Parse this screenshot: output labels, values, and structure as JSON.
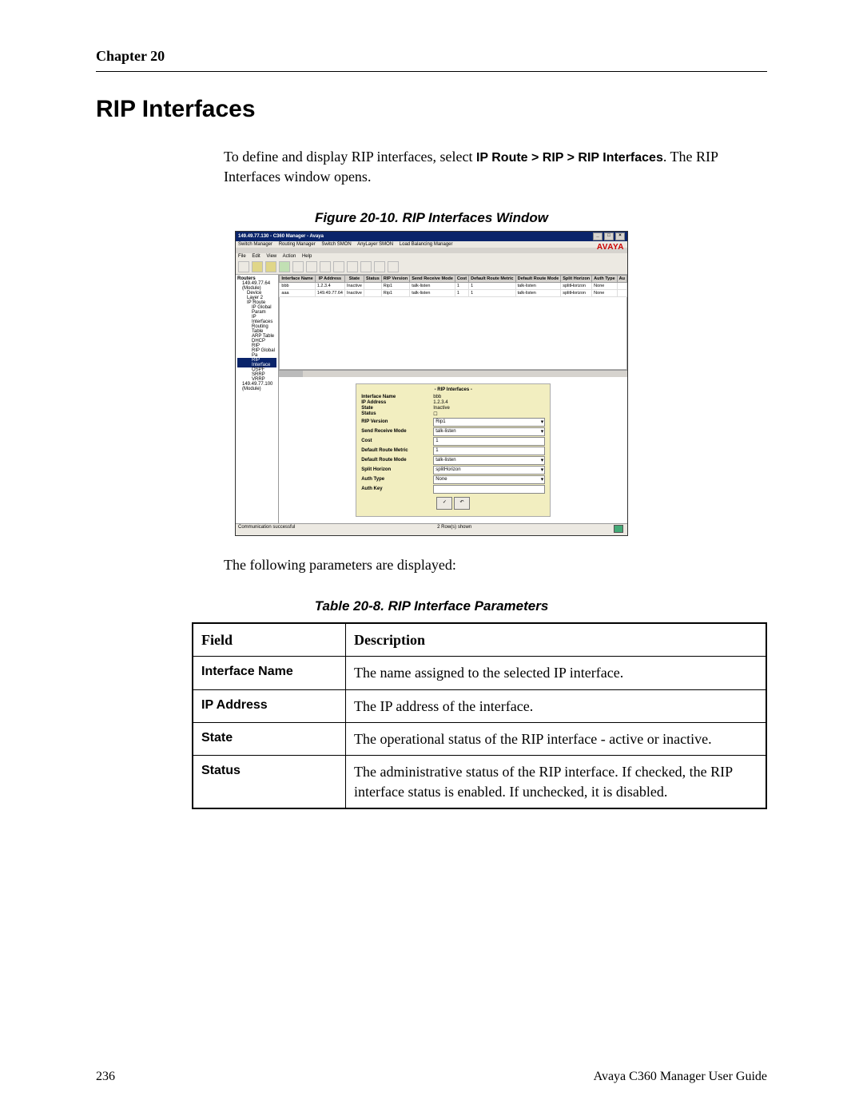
{
  "header": {
    "chapter": "Chapter 20"
  },
  "title": "RIP Interfaces",
  "intro": {
    "pre": "To define and display RIP interfaces, select ",
    "path": "IP Route > RIP > RIP Interfaces",
    "post": ". The RIP Interfaces window opens."
  },
  "figure_caption": "Figure 20-10. RIP Interfaces Window",
  "screenshot": {
    "titlebar": "149.49.77.130 - C360 Manager - Avaya",
    "logo": "AVAYA",
    "tabs": [
      "Switch Manager",
      "Routing Manager",
      "Switch SMON",
      "AnyLayer SMON",
      "Load Balancing Manager"
    ],
    "menus": [
      "File",
      "Edit",
      "View",
      "Action",
      "Help"
    ],
    "tree": [
      {
        "t": "Routers",
        "lvl": 0
      },
      {
        "t": "149.49.77.64 (Module)",
        "lvl": 1
      },
      {
        "t": "Device",
        "lvl": 2
      },
      {
        "t": "Layer 2",
        "lvl": 2
      },
      {
        "t": "IP Route",
        "lvl": 2
      },
      {
        "t": "IP Global Param",
        "lvl": 3
      },
      {
        "t": "IP Interfaces",
        "lvl": 3
      },
      {
        "t": "Routing Table",
        "lvl": 3
      },
      {
        "t": "ARP Table",
        "lvl": 3
      },
      {
        "t": "DHCP",
        "lvl": 3
      },
      {
        "t": "RIP",
        "lvl": 3
      },
      {
        "t": "RIP Global Pa",
        "lvl": 3
      },
      {
        "t": "RIP Interface",
        "lvl": 3,
        "sel": true
      },
      {
        "t": "OSPF",
        "lvl": 3
      },
      {
        "t": "SRRP",
        "lvl": 3
      },
      {
        "t": "VRRP",
        "lvl": 3
      },
      {
        "t": "149.49.77.100 (Module)",
        "lvl": 1
      }
    ],
    "grid": {
      "headers": [
        "Interface Name",
        "IP Address",
        "State",
        "Status",
        "RIP Version",
        "Send Receive Mode",
        "Cost",
        "Default Route Metric",
        "Default Route Mode",
        "Split Horizon",
        "Auth Type",
        "Au"
      ],
      "rows": [
        [
          "bbb",
          "1.2.3.4",
          "Inactive",
          "",
          "Rip1",
          "talk-listen",
          "1",
          "1",
          "talk-listen",
          "splitHorizon",
          "None",
          ""
        ],
        [
          "aaa",
          "149.49.77.64",
          "Inactive",
          "",
          "Rip1",
          "talk-listen",
          "1",
          "1",
          "talk-listen",
          "splitHorizon",
          "None",
          ""
        ]
      ]
    },
    "form": {
      "title": "- RIP Interfaces -",
      "rows": [
        {
          "label": "Interface Name",
          "value": "bbb",
          "type": "text"
        },
        {
          "label": "IP Address",
          "value": "1.2.3.4",
          "type": "text"
        },
        {
          "label": "State",
          "value": "Inactive",
          "type": "text"
        },
        {
          "label": "Status",
          "value": "",
          "type": "check"
        },
        {
          "label": "RIP Version",
          "value": "Rip1",
          "type": "dd"
        },
        {
          "label": "Send Receive Mode",
          "value": "talk-listen",
          "type": "dd"
        },
        {
          "label": "Cost",
          "value": "1",
          "type": "field"
        },
        {
          "label": "Default Route Metric",
          "value": "1",
          "type": "field"
        },
        {
          "label": "Default Route Mode",
          "value": "talk-listen",
          "type": "dd"
        },
        {
          "label": "Split Horizon",
          "value": "splitHorizon",
          "type": "dd"
        },
        {
          "label": "Auth Type",
          "value": "None",
          "type": "dd"
        },
        {
          "label": "Auth Key",
          "value": "",
          "type": "field"
        }
      ],
      "apply": "✓",
      "undo": "↶"
    },
    "status": {
      "left": "Communication successful",
      "center": "2 Row(s) shown"
    }
  },
  "after_figure": "The following parameters are displayed:",
  "table_caption": "Table 20-8. RIP Interface Parameters",
  "params_table": {
    "head": {
      "field": "Field",
      "desc": "Description"
    },
    "rows": [
      {
        "field": "Interface Name",
        "desc": "The name assigned to the selected IP interface."
      },
      {
        "field": "IP Address",
        "desc": "The IP address of the interface."
      },
      {
        "field": "State",
        "desc": "The operational status of the RIP interface - active or inactive."
      },
      {
        "field": "Status",
        "desc": "The administrative status of the RIP interface. If checked, the RIP interface status is enabled. If unchecked, it is disabled."
      }
    ]
  },
  "footer": {
    "page": "236",
    "guide": "Avaya C360 Manager User Guide"
  }
}
